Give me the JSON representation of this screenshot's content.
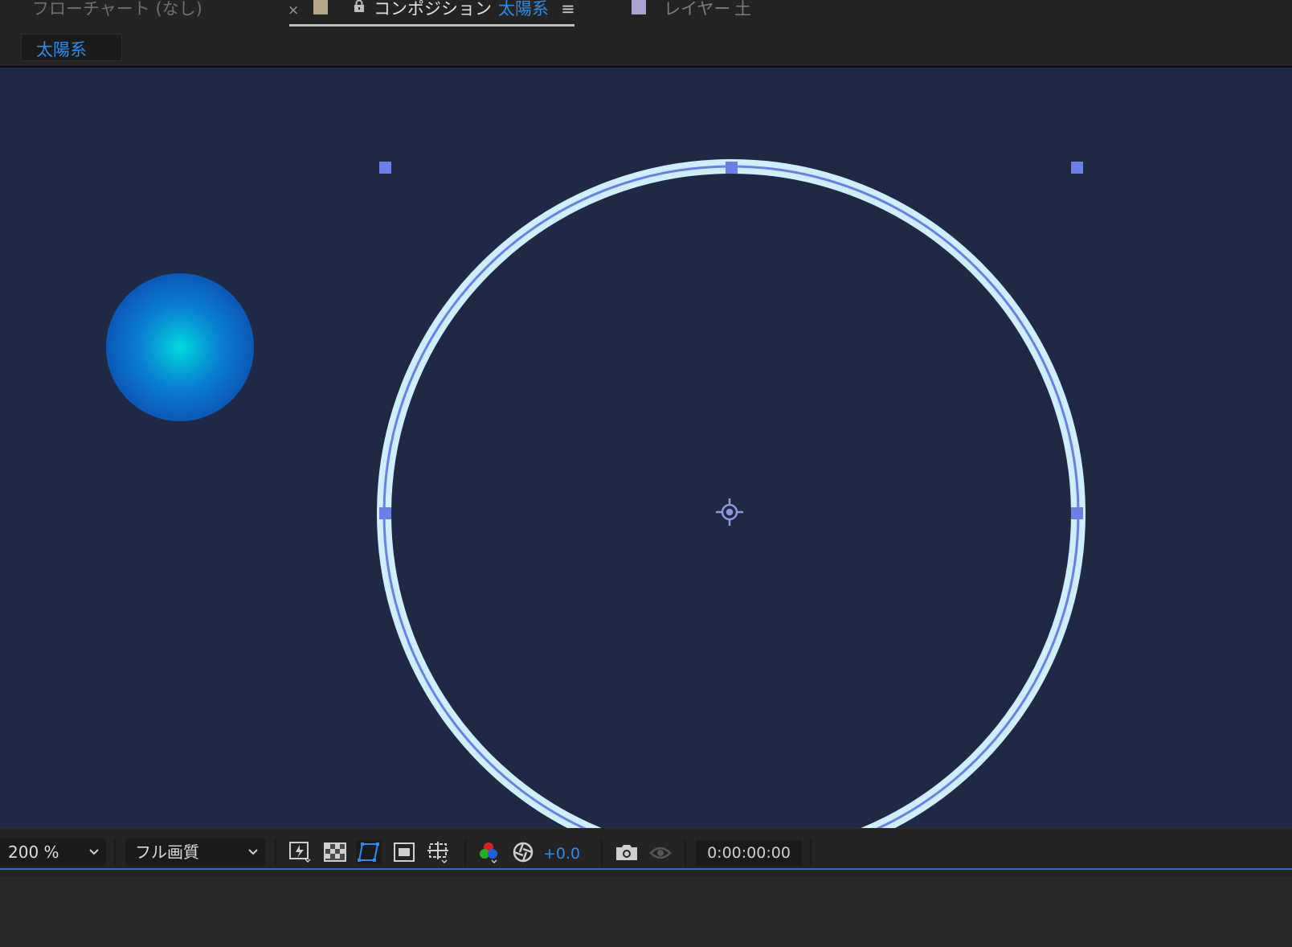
{
  "tabs": {
    "flowchart": {
      "label": "フローチャート (なし)"
    },
    "composition": {
      "prefix": "コンポジション",
      "name": "太陽系",
      "close": "×",
      "menu": "≡"
    },
    "layer": {
      "prefix": "レイヤー",
      "name": "土"
    }
  },
  "breadcrumb": {
    "label": "太陽系"
  },
  "toolbar": {
    "zoom": "200 %",
    "resolution": "フル画質",
    "exposure": "+0.0",
    "timecode": "0:00:00:00"
  },
  "colors": {
    "viewer_bg": "#1f2944",
    "accent": "#2d8ceb",
    "handle": "#6b7fe8",
    "ring": "#cfefff",
    "comp_swatch": "#b5a585",
    "layer_swatch": "#a9a4d6"
  }
}
